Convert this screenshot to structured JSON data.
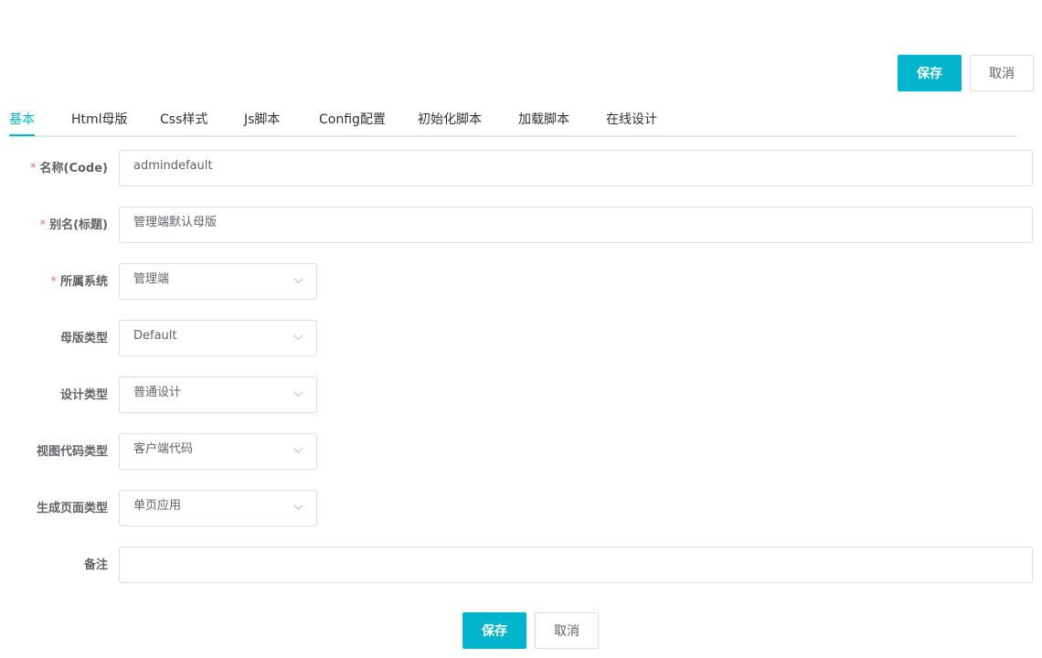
{
  "header": {
    "save_label": "保存",
    "cancel_label": "取消"
  },
  "tabs": [
    {
      "label": "基本",
      "active": true
    },
    {
      "label": "Html母版",
      "active": false
    },
    {
      "label": "Css样式",
      "active": false
    },
    {
      "label": "Js脚本",
      "active": false
    },
    {
      "label": "Config配置",
      "active": false
    },
    {
      "label": "初始化脚本",
      "active": false
    },
    {
      "label": "加载脚本",
      "active": false
    },
    {
      "label": "在线设计",
      "active": false
    }
  ],
  "form": {
    "fields": [
      {
        "label": "名称(Code)",
        "required": true,
        "value": "admindefault",
        "type": "text"
      },
      {
        "label": "别名(标题)",
        "required": true,
        "value": "管理端默认母版",
        "type": "text"
      },
      {
        "label": "所属系统",
        "required": true,
        "value": "管理端",
        "type": "select"
      },
      {
        "label": "母版类型",
        "required": false,
        "value": "Default",
        "type": "select"
      },
      {
        "label": "设计类型",
        "required": false,
        "value": "普通设计",
        "type": "select"
      },
      {
        "label": "视图代码类型",
        "required": false,
        "value": "客户端代码",
        "type": "select"
      },
      {
        "label": "生成页面类型",
        "required": false,
        "value": "单页应用",
        "type": "select"
      },
      {
        "label": "备注",
        "required": false,
        "value": "",
        "type": "text"
      }
    ],
    "required_mark": "*"
  },
  "footer": {
    "save_label": "保存",
    "cancel_label": "取消"
  },
  "colors": {
    "primary": "#00b5cc",
    "required": "#f56c6c",
    "border": "#dcdfe6"
  }
}
